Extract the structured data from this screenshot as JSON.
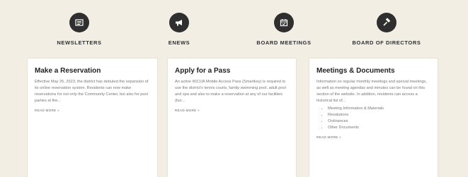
{
  "nav": [
    {
      "label": "NEWSLETTERS",
      "icon": "newsletter-icon"
    },
    {
      "label": "ENEWS",
      "icon": "megaphone-icon"
    },
    {
      "label": "BOARD MEETINGS",
      "icon": "calendar-icon"
    },
    {
      "label": "BOARD OF DIRECTORS",
      "icon": "gavel-icon"
    }
  ],
  "cards": [
    {
      "title": "Make a Reservation",
      "body": "Effective May 25, 2023, the district has debuted the expansion of its online reservation system. Residents can now make reservations for not only the Community Center, but also for pool parties at the...",
      "link": "READ MORE »"
    },
    {
      "title": "Apply for a Pass",
      "body": "An active WZJJA Mobile Access Pass (Smartkey) is required to use the district's tennis courts, family swimming pool, adult pool and spa and also to make a reservation at any of our facilities (fun...",
      "link": "READ MORE »"
    },
    {
      "title": "Meetings & Documents",
      "body": "Information on regular monthly meetings and special meetings, as well as meeting agendas and minutes can be found on this section of the website. In addition, residents can access a historical list of...",
      "list": [
        "Meeting Information & Materials",
        "Resolutions",
        "Ordinances",
        "Other Documents"
      ],
      "link": "READ MORE »"
    }
  ],
  "colors": {
    "background": "#f3eee4",
    "icon_circle": "#2f2f2f",
    "card": "#ffffff"
  }
}
